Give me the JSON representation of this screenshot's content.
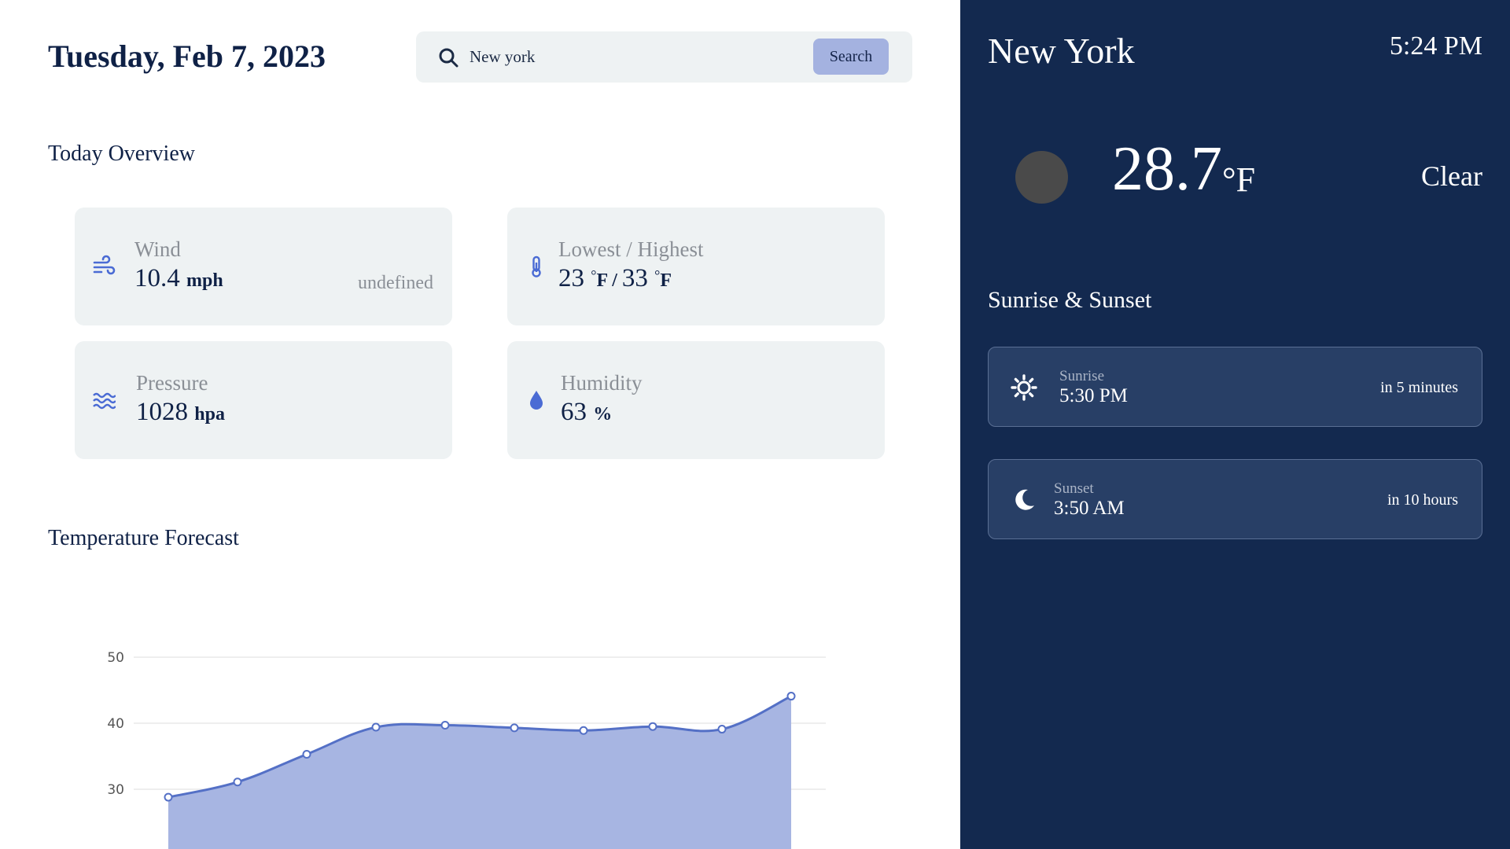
{
  "header": {
    "date": "Tuesday, Feb 7, 2023"
  },
  "search": {
    "value": "New york",
    "button_label": "Search",
    "icon": "search-icon"
  },
  "overview": {
    "title": "Today Overview",
    "wind": {
      "label": "Wind",
      "value": "10.4",
      "unit": "mph",
      "direction": "undefined",
      "icon": "wind-icon"
    },
    "temp_range": {
      "label": "Lowest / Highest",
      "low": "23",
      "high": "33",
      "deg": "°",
      "unit": "F",
      "icon": "thermometer-icon"
    },
    "pressure": {
      "label": "Pressure",
      "value": "1028",
      "unit": "hpa",
      "icon": "pressure-waves-icon"
    },
    "humidity": {
      "label": "Humidity",
      "value": "63",
      "unit": "%",
      "icon": "water-drop-icon"
    }
  },
  "forecast": {
    "title": "Temperature Forecast"
  },
  "chart_data": {
    "type": "area",
    "title": "",
    "xlabel": "",
    "ylabel": "",
    "y_ticks": [
      30,
      40,
      50
    ],
    "ylim": [
      20,
      50
    ],
    "grid": true,
    "color": "#5470c6",
    "fill": "#a7b5e2",
    "series": [
      {
        "values": [
          28.8,
          31.1,
          35.3,
          39.4,
          39.7,
          39.3,
          38.9,
          39.5,
          39.1,
          44.1
        ]
      }
    ]
  },
  "current": {
    "city": "New York",
    "time": "5:24 PM",
    "temperature": "28.7",
    "unit": "°F",
    "condition": "Clear",
    "icon": "weather-condition-icon"
  },
  "sun": {
    "title": "Sunrise & Sunset",
    "sunrise": {
      "label": "Sunrise",
      "time": "5:30 PM",
      "relative": "in 5 minutes",
      "icon": "sun-icon"
    },
    "sunset": {
      "label": "Sunset",
      "time": "3:50 AM",
      "relative": "in 10 hours",
      "icon": "moon-icon"
    }
  },
  "colors": {
    "panel_bg": "#13294f",
    "card_bg": "#eef2f3",
    "accent": "#5470c6",
    "search_button": "#a4b2e0"
  }
}
